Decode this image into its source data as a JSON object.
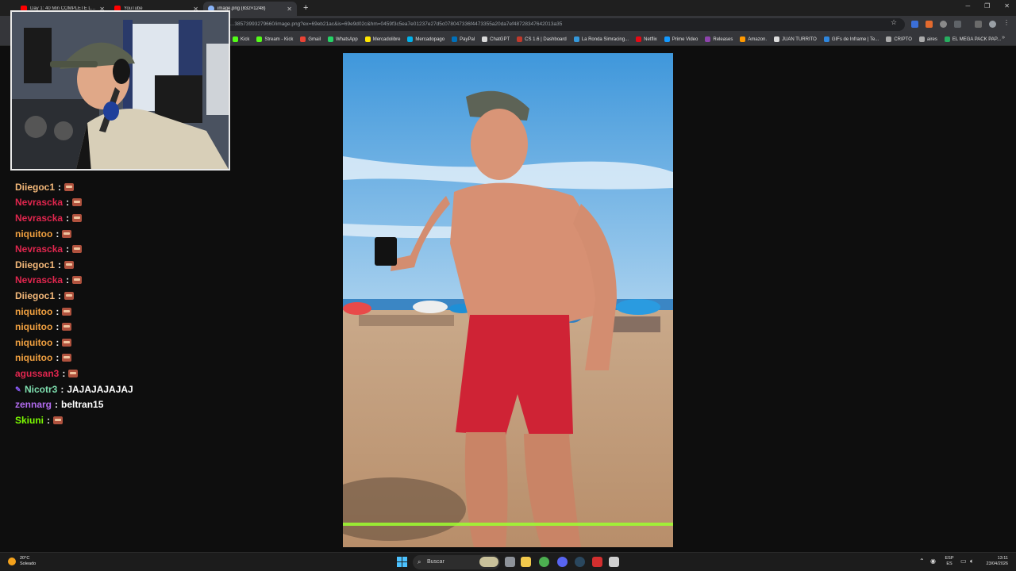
{
  "browser": {
    "tabs": [
      {
        "title": "Day 1: 40 Min COMPLETE LOW...",
        "favicon": "youtube-icon",
        "active": false
      },
      {
        "title": "YouTube",
        "favicon": "youtube-icon",
        "active": false
      },
      {
        "title": "image.png (832×1248)",
        "favicon": "image-icon",
        "active": true
      }
    ],
    "new_tab_label": "+",
    "address": "...38573993279660/image.png?ex=69eb21ac&is=69e9d02c&hm=0459f3c5ea7e01237e27d5c078047336f4473355a20da7ef48728347642013a35",
    "bookmarks": [
      {
        "label": "Kick",
        "color": "#53fc18"
      },
      {
        "label": "Stream - Kick",
        "color": "#53fc18"
      },
      {
        "label": "Gmail",
        "color": "#ea4335"
      },
      {
        "label": "WhatsApp",
        "color": "#25d366"
      },
      {
        "label": "Mercadolibre",
        "color": "#ffe600"
      },
      {
        "label": "Mercadopago",
        "color": "#00b1ea"
      },
      {
        "label": "PayPal",
        "color": "#0070ba"
      },
      {
        "label": "ChatGPT",
        "color": "#d9d9d9"
      },
      {
        "label": "CS 1.6 | Dashboard",
        "color": "#c0392b"
      },
      {
        "label": "La Ronda Simracing...",
        "color": "#3498db"
      },
      {
        "label": "Netflix",
        "color": "#e50914"
      },
      {
        "label": "Prime Video",
        "color": "#1399ff"
      },
      {
        "label": "Releases",
        "color": "#8e44ad"
      },
      {
        "label": "Amazon.",
        "color": "#ff9900"
      },
      {
        "label": "JUAN TURRITO",
        "color": "#dddddd"
      },
      {
        "label": "GIFs de Inframe | Te...",
        "color": "#2e86de"
      },
      {
        "label": "CRIPTO",
        "color": "#aaaaaa"
      },
      {
        "label": "aires",
        "color": "#aaaaaa"
      },
      {
        "label": "EL MEGA PACK PAP...",
        "color": "#27ae60"
      }
    ],
    "bookmarks_more": "»"
  },
  "chat": {
    "messages": [
      {
        "user": "Diiegoc1",
        "color": "#f5b97a",
        "text": "",
        "emote": true,
        "badge": false
      },
      {
        "user": "Nevrascka",
        "color": "#e0264e",
        "text": "",
        "emote": true,
        "badge": false
      },
      {
        "user": "Nevrascka",
        "color": "#e0264e",
        "text": "",
        "emote": true,
        "badge": false
      },
      {
        "user": "niquitoo",
        "color": "#f0a040",
        "text": "",
        "emote": true,
        "badge": false
      },
      {
        "user": "Nevrascka",
        "color": "#e0264e",
        "text": "",
        "emote": true,
        "badge": false
      },
      {
        "user": "Diiegoc1",
        "color": "#f5b97a",
        "text": "",
        "emote": true,
        "badge": false
      },
      {
        "user": "Nevrascka",
        "color": "#e0264e",
        "text": "",
        "emote": true,
        "badge": false
      },
      {
        "user": "Diiegoc1",
        "color": "#f5b97a",
        "text": "",
        "emote": true,
        "badge": false
      },
      {
        "user": "niquitoo",
        "color": "#f0a040",
        "text": "",
        "emote": true,
        "badge": false
      },
      {
        "user": "niquitoo",
        "color": "#f0a040",
        "text": "",
        "emote": true,
        "badge": false
      },
      {
        "user": "niquitoo",
        "color": "#f0a040",
        "text": "",
        "emote": true,
        "badge": false
      },
      {
        "user": "niquitoo",
        "color": "#f0a040",
        "text": "",
        "emote": true,
        "badge": false
      },
      {
        "user": "agussan3",
        "color": "#e0264e",
        "text": "",
        "emote": true,
        "badge": false
      },
      {
        "user": "Nicotr3",
        "color": "#7fe0b0",
        "text": "JAJAJAJAJAJ",
        "emote": false,
        "badge": true
      },
      {
        "user": "zennarg",
        "color": "#b36cf0",
        "text": "beltran15",
        "emote": false,
        "badge": false
      },
      {
        "user": "Skiuni",
        "color": "#7cfc00",
        "text": "",
        "emote": true,
        "badge": false
      }
    ]
  },
  "taskbar": {
    "weather_temp": "20°C",
    "weather_desc": "Soleado",
    "search_placeholder": "Buscar",
    "lang_top": "ESP",
    "lang_bottom": "ES",
    "time": "13:11",
    "date": "23/04/2026"
  }
}
